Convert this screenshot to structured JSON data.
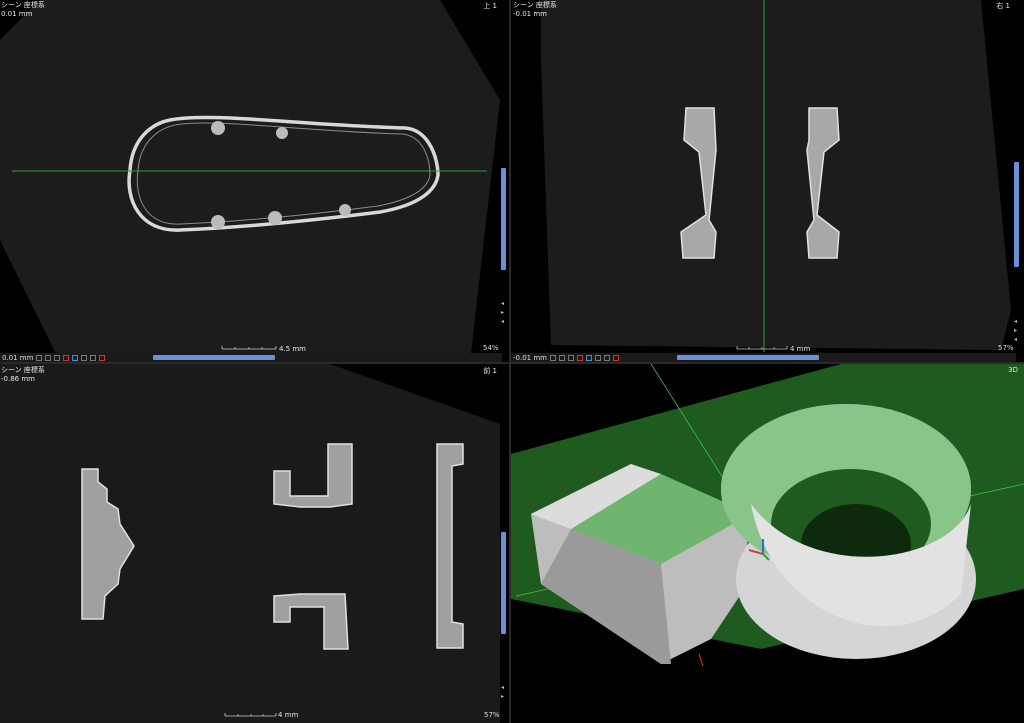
{
  "panes": {
    "top_left": {
      "label": "シーン 座標系",
      "offset": "0.01 mm",
      "corner": "上 1",
      "scale_label": "4.5 mm",
      "zoom": "54%",
      "toolbar_value": "0.01 mm"
    },
    "top_right": {
      "label": "シーン 座標系",
      "offset": "-0.01 mm",
      "corner": "右 1",
      "scale_label": "4 mm",
      "zoom": "57%",
      "toolbar_value": "-0.01 mm"
    },
    "bottom_left": {
      "label": "シーン 座標系",
      "offset": "-0.86 mm",
      "corner": "前 1",
      "scale_label": "4 mm",
      "zoom": "57%"
    },
    "bottom_right": {
      "corner": "3D"
    }
  },
  "colors": {
    "crosshair": "#2f9e3a",
    "plane": "#1f5a1f",
    "scrollbar": "#6d8fd6",
    "slice_bg": "#1c1c1c"
  }
}
